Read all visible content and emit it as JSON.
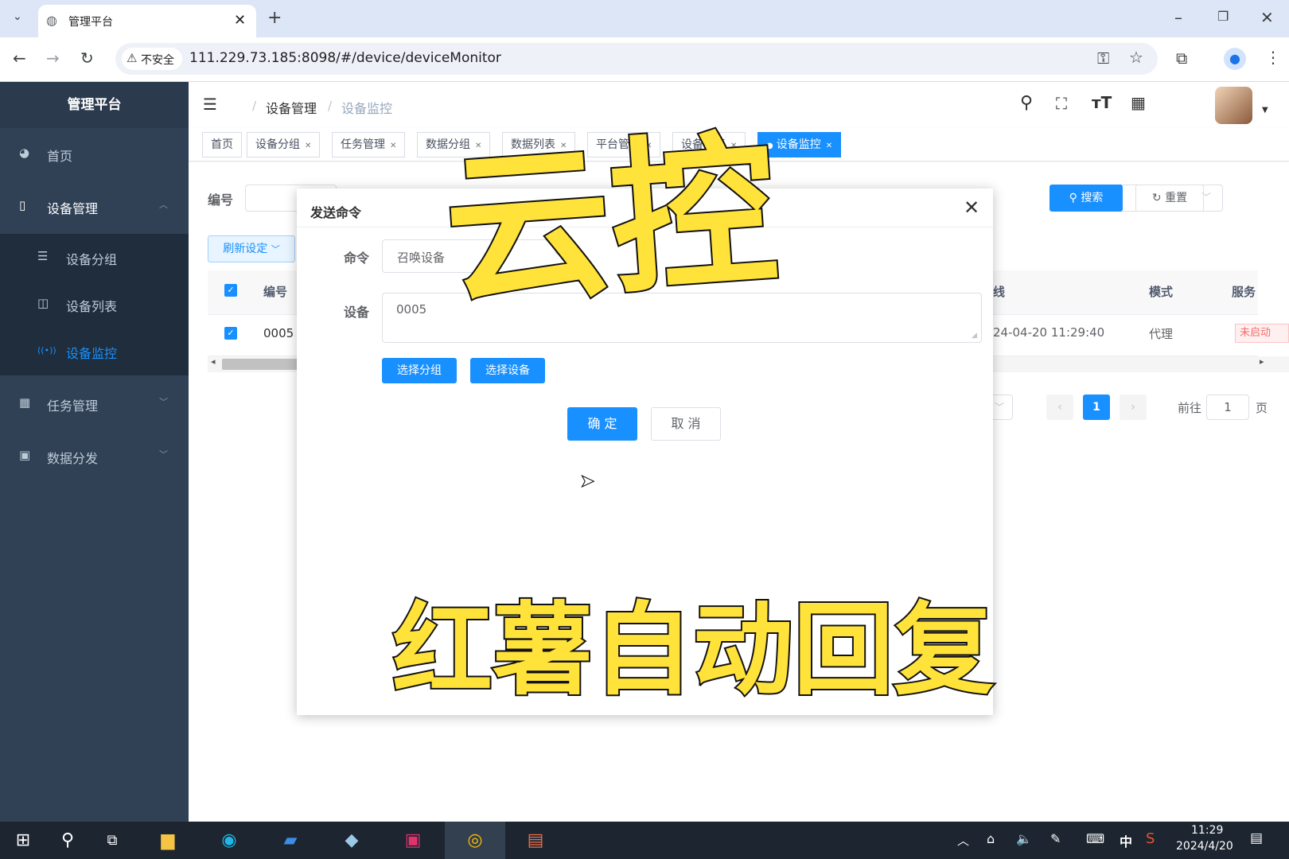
{
  "browser": {
    "tab_title": "管理平台",
    "security_label": "不安全",
    "url": "111.229.73.185:8098/#/device/deviceMonitor"
  },
  "sidebar": {
    "logo": "管理平台",
    "items": [
      {
        "label": "首页"
      },
      {
        "label": "设备管理"
      },
      {
        "label": "任务管理"
      },
      {
        "label": "数据分发"
      }
    ],
    "sub_items": [
      {
        "label": "设备分组"
      },
      {
        "label": "设备列表"
      },
      {
        "label": "设备监控"
      }
    ]
  },
  "header": {
    "breadcrumb": [
      "设备管理",
      "设备监控"
    ]
  },
  "tags": [
    {
      "label": "首页"
    },
    {
      "label": "设备分组"
    },
    {
      "label": "任务管理"
    },
    {
      "label": "数据分组"
    },
    {
      "label": "数据列表"
    },
    {
      "label": "平台管理"
    },
    {
      "label": "设备列表"
    },
    {
      "label": "设备监控"
    }
  ],
  "filters": {
    "number_label": "编号",
    "search_label": "搜索",
    "reset_label": "重置",
    "refresh_label": "刷新设定"
  },
  "table": {
    "headers": {
      "number": "编号",
      "online": "线",
      "mode": "模式",
      "service": "服务"
    },
    "row": {
      "number": "0005",
      "time": "24-04-20 11:29:40",
      "mode": "代理",
      "status": "未启动"
    }
  },
  "pagination": {
    "current": "1",
    "goto_label": "前往",
    "goto_value": "1",
    "page_unit": "页"
  },
  "dialog": {
    "title": "发送命令",
    "command_label": "命令",
    "command_value": "召唤设备",
    "device_label": "设备",
    "device_value": "0005",
    "select_group": "选择分组",
    "select_device": "选择设备",
    "confirm": "确 定",
    "cancel": "取 消"
  },
  "overlay_text": {
    "top": "云控",
    "bottom": "红薯自动回复"
  },
  "taskbar": {
    "time": "11:29",
    "date": "2024/4/20",
    "ime": "中"
  },
  "colors": {
    "primary": "#1890ff",
    "sidebar": "#304156",
    "highlight_text": "#ffe23a"
  }
}
